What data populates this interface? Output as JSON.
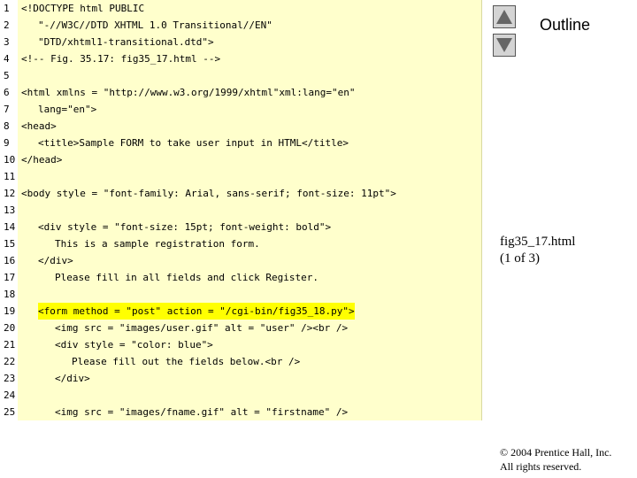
{
  "nav": {
    "up_icon": "triangle-up-icon",
    "down_icon": "triangle-down-icon"
  },
  "outline_label": "Outline",
  "file": {
    "name": "fig35_17.html",
    "page": "(1 of 3)"
  },
  "copyright": {
    "line1": "© 2004 Prentice Hall, Inc.",
    "line2": "All rights reserved."
  },
  "colors": {
    "code_bg": "#ffffcc",
    "highlight": "#ffff00",
    "string": "#1a1aa0"
  },
  "code_lines": [
    {
      "num": "1",
      "indent": 0,
      "text": "<!DOCTYPE html PUBLIC"
    },
    {
      "num": "2",
      "indent": 2,
      "text": "\"-//W3C//DTD XHTML 1.0 Transitional//EN\""
    },
    {
      "num": "3",
      "indent": 2,
      "text": "\"DTD/xhtml1-transitional.dtd\">"
    },
    {
      "num": "4",
      "indent": 0,
      "text": "<!-- Fig. 35.17: fig35_17.html -->"
    },
    {
      "num": "5",
      "indent": 0,
      "text": ""
    },
    {
      "num": "6",
      "indent": 0,
      "text": "<html xmlns = \"http://www.w3.org/1999/xhtml\"xml:lang=\"en\""
    },
    {
      "num": "7",
      "indent": 2,
      "text": "lang=\"en\">"
    },
    {
      "num": "8",
      "indent": 0,
      "text": "<head>"
    },
    {
      "num": "9",
      "indent": 2,
      "text": "<title>Sample FORM to take user input in HTML</title>"
    },
    {
      "num": "10",
      "indent": 0,
      "text": "</head>"
    },
    {
      "num": "11",
      "indent": 0,
      "text": ""
    },
    {
      "num": "12",
      "indent": 0,
      "text": "<body style = \"font-family: Arial, sans-serif; font-size: 11pt\">"
    },
    {
      "num": "13",
      "indent": 0,
      "text": ""
    },
    {
      "num": "14",
      "indent": 2,
      "text": "<div style = \"font-size: 15pt; font-weight: bold\">"
    },
    {
      "num": "15",
      "indent": 4,
      "text": "This is a sample registration form."
    },
    {
      "num": "16",
      "indent": 2,
      "text": "</div>"
    },
    {
      "num": "17",
      "indent": 4,
      "text": "Please fill in all fields and click Register."
    },
    {
      "num": "18",
      "indent": 0,
      "text": ""
    },
    {
      "num": "19",
      "indent": 2,
      "text": "<form method = \"post\" action = \"/cgi-bin/fig35_18.py\">",
      "highlight": true
    },
    {
      "num": "20",
      "indent": 4,
      "text": "<img src = \"images/user.gif\" alt = \"user\" /><br />"
    },
    {
      "num": "21",
      "indent": 4,
      "text": "<div style = \"color: blue\">"
    },
    {
      "num": "22",
      "indent": 6,
      "text": "Please fill out the fields below.<br />"
    },
    {
      "num": "23",
      "indent": 4,
      "text": "</div>"
    },
    {
      "num": "24",
      "indent": 0,
      "text": ""
    },
    {
      "num": "25",
      "indent": 4,
      "text": "<img src = \"images/fname.gif\" alt = \"firstname\" />"
    }
  ]
}
